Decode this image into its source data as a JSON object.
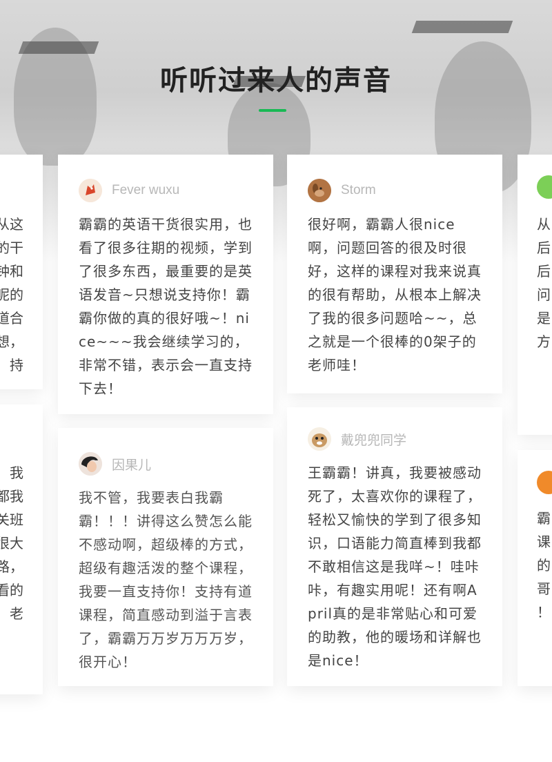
{
  "section": {
    "title": "听听过来人的声音",
    "accent_color": "#19b955"
  },
  "cards": [
    {
      "name": "Fever wuxu",
      "avatar_icon": "dragon-avatar-icon",
      "text": "霸霸的英语干货很实用，也看了很多往期的视频，学到了很多东西，最重要的是英语发音~只想说支持你！霸霸你做的真的很好哦~！nice~~~我会继续学习的，非常不错，表示会一直支持下去！"
    },
    {
      "name": "Storm",
      "avatar_icon": "dog-avatar-icon",
      "text": "很好啊，霸霸人很nice啊，问题回答的很及时很好，这样的课程对我来说真的很有帮助，从根本上解决了我的很多问题哈~~，总之就是一个很棒的0架子的老师哇！"
    },
    {
      "name": "因果儿",
      "avatar_icon": "person-avatar-icon",
      "text": "我不管，我要表白我霸霸！！！讲得这么赞怎么能不感动啊，超级棒的方式，超级有趣活泼的整个课程，我要一直支持你！支持有道课程，简直感动到溢于言表了，霸霸万万岁万万万岁，很开心！"
    },
    {
      "name": "戴兜兜同学",
      "avatar_icon": "cartoon-dog-avatar-icon",
      "text": "王霸霸！讲真，我要被感动死了，太喜欢你的课程了，轻松又愉快的学到了很多知识，口语能力简直棒到我都不敢相信这是我咩~！哇咔咔，有趣实用呢！还有啊April真的是非常贴心和可爱的助教，他的暖场和详解也是nice！"
    }
  ],
  "left_partial": {
    "top_lines": [
      "从这",
      "的干",
      "钟和",
      "呢的",
      "道合",
      "想，",
      "持"
    ],
    "bottom_lines": [
      "我",
      "都我",
      "关班",
      "很大",
      "路，",
      "看的",
      "老"
    ]
  },
  "right_partial": {
    "top_lines": [
      "从",
      "后",
      "后",
      "问",
      "是",
      "方"
    ],
    "bottom_lines": [
      "霸",
      "课",
      "的",
      "哥",
      "！"
    ]
  }
}
